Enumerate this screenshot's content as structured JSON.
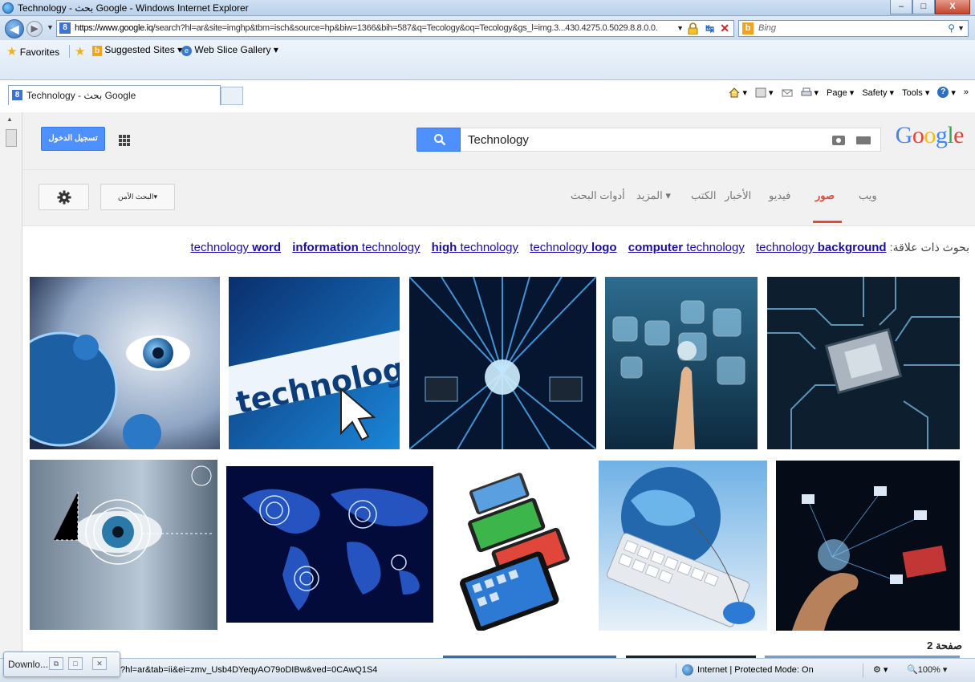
{
  "window": {
    "title": "Technology - بحث Google - Windows Internet Explorer",
    "minimize": "–",
    "maximize": "□",
    "close": "X"
  },
  "address": {
    "url_host": "https://www.google.iq",
    "url_rest": "/search?hl=ar&site=imghp&tbm=isch&source=hp&biw=1366&bih=587&q=Tecology&oq=Tecology&gs_l=img.3...430.4275.0.5029.8.8.0.0.",
    "search_placeholder": "Bing"
  },
  "favorites": {
    "favorites_label": "Favorites",
    "suggested_sites": "Suggested Sites ▾",
    "web_slice": "Web Slice Gallery ▾"
  },
  "tab": {
    "label": "Technology - بحث Google"
  },
  "command_bar": {
    "page": "Page ▾",
    "safety": "Safety ▾",
    "tools": "Tools ▾"
  },
  "google": {
    "signin_label": "تسجيل الدخول",
    "query": "Technology",
    "logo_letters": [
      "G",
      "o",
      "o",
      "g",
      "l",
      "e"
    ],
    "safesearch_label": "البحث الآمن▾",
    "tabs": [
      {
        "label": "ويب",
        "active": false
      },
      {
        "label": "صور",
        "active": true
      },
      {
        "label": "فيديو",
        "active": false
      },
      {
        "label": "الأخبار",
        "active": false
      },
      {
        "label": "الكتب",
        "active": false
      },
      {
        "label": "المزيد ▾",
        "active": false
      },
      {
        "label": "أدوات البحث",
        "active": false
      }
    ],
    "related_label": "بحوث ذات علاقة:",
    "related": [
      {
        "plain": "technology ",
        "bold": "background",
        "bold_first": false
      },
      {
        "plain": " technology",
        "bold": "computer",
        "bold_first": true
      },
      {
        "plain": "technology ",
        "bold": "logo",
        "bold_first": false
      },
      {
        "plain": " technology",
        "bold": "high",
        "bold_first": true
      },
      {
        "plain": " technology",
        "bold": "information",
        "bold_first": true
      },
      {
        "plain": "technology ",
        "bold": "word",
        "bold_first": false
      }
    ],
    "image_row1": [
      {
        "name": "eye-earth-image"
      },
      {
        "name": "technology-word-image"
      },
      {
        "name": "binary-tunnel-image"
      },
      {
        "name": "touch-screen-image"
      },
      {
        "name": "circuit-chip-image"
      }
    ],
    "image_row2": [
      {
        "name": "eye-scan-image"
      },
      {
        "name": "world-map-network-image"
      },
      {
        "name": "smartphones-image"
      },
      {
        "name": "keyboard-globe-image"
      },
      {
        "name": "hand-network-image"
      }
    ],
    "page_label": "صفحة 2"
  },
  "status": {
    "url": "?hl=ar&tab=ii&ei=zmv_Usb4DYeqyAO79oDIBw&ved=0CAwQ1S4",
    "zone": "Internet | Protected Mode: On",
    "zoom": "100%",
    "download_label": "Downlo..."
  },
  "colors": {
    "google_blue": "#4d90fe",
    "google_red": "#dd4b39",
    "link": "#1a0dab"
  }
}
